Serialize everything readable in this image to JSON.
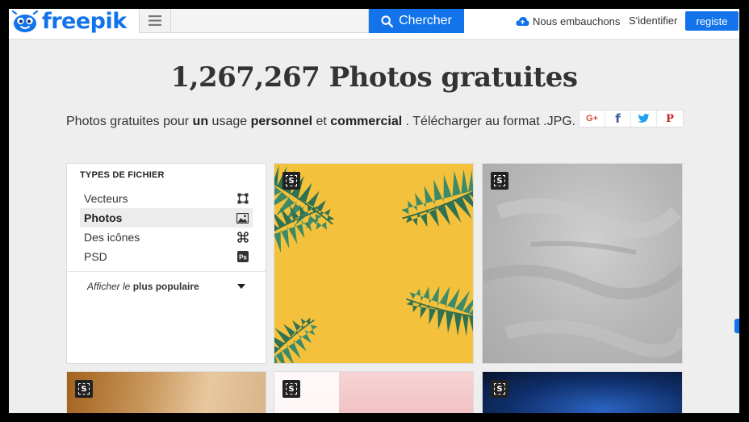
{
  "header": {
    "logo_text": "freepik",
    "search": {
      "value": "",
      "placeholder": ""
    },
    "search_button": "Chercher",
    "hiring": "Nous embauchons",
    "login": "S'identifier",
    "register": "registe"
  },
  "main": {
    "title": "1,267,267 Photos gratuites",
    "subtitle": {
      "p1": "Photos gratuites pour ",
      "b1": "un",
      "p2": " usage ",
      "b2": "personnel",
      "p3": " et ",
      "b3": "commercial",
      "p4": " . Télécharger au format .JPG."
    },
    "share": {
      "google": "G+",
      "facebook": "f",
      "twitter": "twitter-icon",
      "pinterest": "P"
    }
  },
  "sidebar": {
    "heading": "TYPES DE FICHIER",
    "items": [
      {
        "label": "Vecteurs",
        "icon": "vector-icon",
        "active": false
      },
      {
        "label": "Photos",
        "icon": "image-icon",
        "active": true
      },
      {
        "label": "Des icônes",
        "icon": "command-icon",
        "active": false
      },
      {
        "label": "PSD",
        "icon": "ps-icon",
        "active": false
      }
    ],
    "sort": {
      "prefix": "Afficher le",
      "value": "plus populaire"
    }
  },
  "photos": [
    {
      "badge": "S",
      "description": "palm-leaves-on-yellow"
    },
    {
      "badge": "S",
      "description": "grey-concrete-texture"
    },
    {
      "badge": "S",
      "description": "blurred-room"
    },
    {
      "badge": "S",
      "description": "pink-paint"
    },
    {
      "badge": "S",
      "description": "blue-bokeh"
    }
  ],
  "colors": {
    "brand": "#1273eb",
    "background": "#eeeeee",
    "header": "#ffffff"
  }
}
